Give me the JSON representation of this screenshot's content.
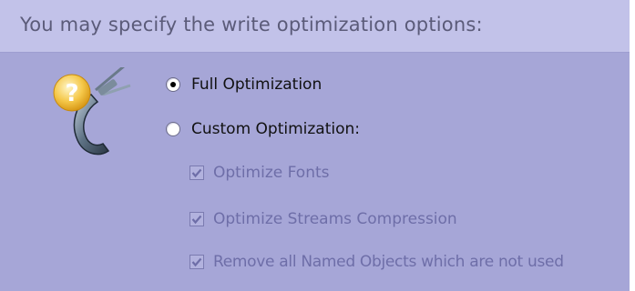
{
  "header": {
    "title": "You may specify the write optimization options:"
  },
  "icons": {
    "wizard": "help-clamp-icon"
  },
  "options": {
    "full": {
      "label": "Full Optimization",
      "selected": true
    },
    "custom": {
      "label": "Custom Optimization:",
      "selected": false
    }
  },
  "custom_options": [
    {
      "label": "Optimize Fonts",
      "checked": true,
      "enabled": false
    },
    {
      "label": "Optimize Streams Compression",
      "checked": true,
      "enabled": false
    },
    {
      "label": "Remove all Named Objects which are not used",
      "checked": true,
      "enabled": false
    }
  ],
  "colors": {
    "panel_bg": "#a6a6d7",
    "header_bg": "#c2c2e9",
    "disabled_text": "#6e6ea8"
  }
}
